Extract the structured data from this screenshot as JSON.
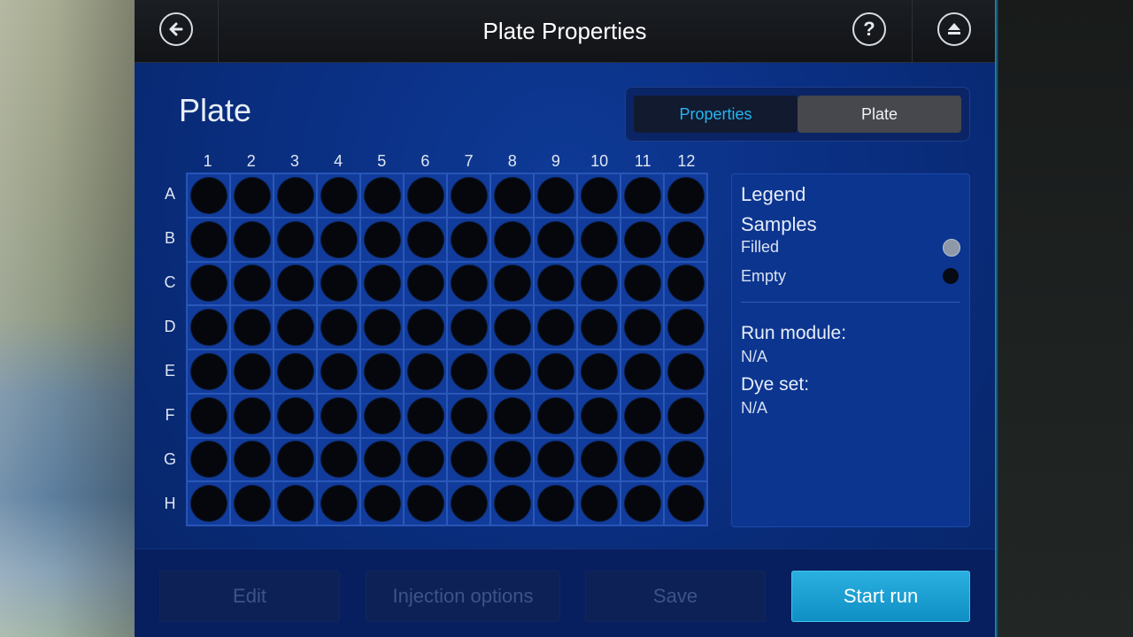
{
  "header": {
    "title": "Plate Properties"
  },
  "plate_heading": "Plate",
  "toggle": {
    "properties_label": "Properties",
    "plate_label": "Plate",
    "active": "properties"
  },
  "plate": {
    "columns": [
      "1",
      "2",
      "3",
      "4",
      "5",
      "6",
      "7",
      "8",
      "9",
      "10",
      "11",
      "12"
    ],
    "rows": [
      "A",
      "B",
      "C",
      "D",
      "E",
      "F",
      "G",
      "H"
    ],
    "well_state": "empty"
  },
  "legend": {
    "title": "Legend",
    "samples_label": "Samples",
    "filled_label": "Filled",
    "empty_label": "Empty",
    "run_module_label": "Run module:",
    "run_module_value": "N/A",
    "dye_set_label": "Dye set:",
    "dye_set_value": "N/A"
  },
  "footer": {
    "edit_label": "Edit",
    "injection_label": "Injection options",
    "save_label": "Save",
    "start_label": "Start run"
  },
  "colors": {
    "accent": "#27b4ee",
    "primary_button": "#1aa0d4",
    "screen_bg": "#0a2f82",
    "well_empty": "#05070c",
    "well_filled": "#8f98a8"
  },
  "icons": {
    "back": "back-arrow-icon",
    "help": "help-icon",
    "eject": "eject-icon"
  }
}
